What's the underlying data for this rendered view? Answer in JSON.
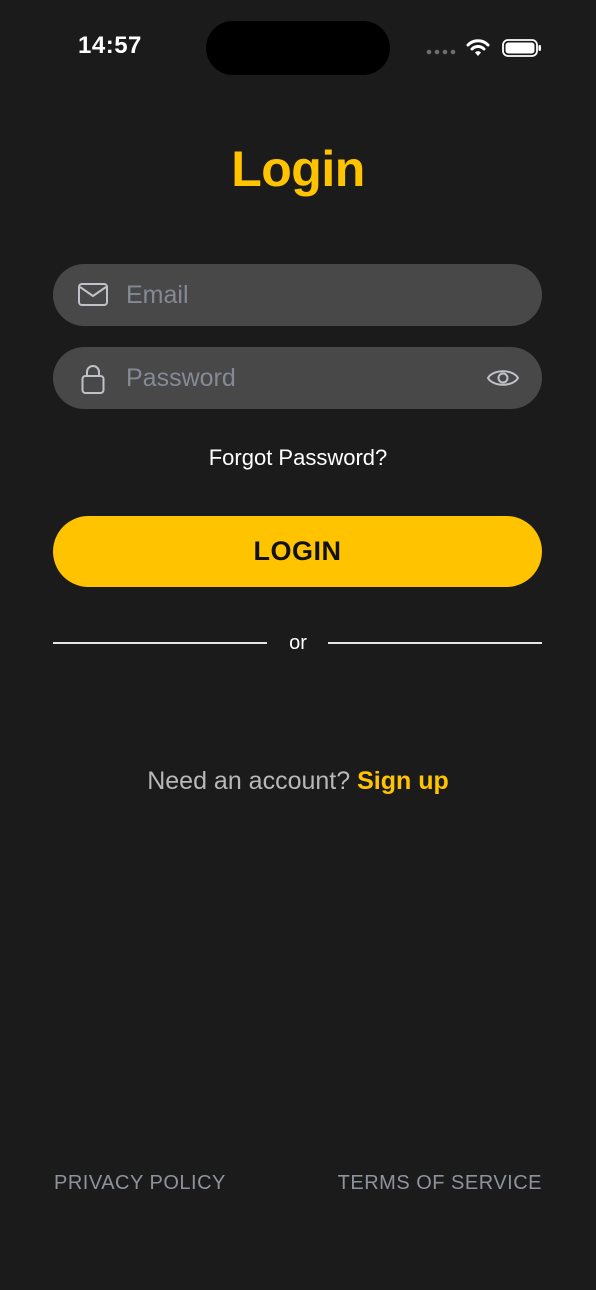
{
  "status_bar": {
    "time": "14:57"
  },
  "title": "Login",
  "email_field": {
    "placeholder": "Email",
    "value": "",
    "icon": "envelope-icon"
  },
  "password_field": {
    "placeholder": "Password",
    "value": "",
    "icon": "lock-icon",
    "toggle_icon": "eye-icon"
  },
  "forgot_password": "Forgot Password?",
  "login_button": "LOGIN",
  "divider_text": "or",
  "signup": {
    "prompt": "Need an account? ",
    "link": "Sign up"
  },
  "footer": {
    "privacy": "PRIVACY POLICY",
    "terms": "TERMS OF SERVICE"
  },
  "colors": {
    "background": "#1b1b1b",
    "accent": "#ffc300",
    "field_background": "#484848",
    "placeholder": "#848a95",
    "footer_text": "#8e939b"
  }
}
